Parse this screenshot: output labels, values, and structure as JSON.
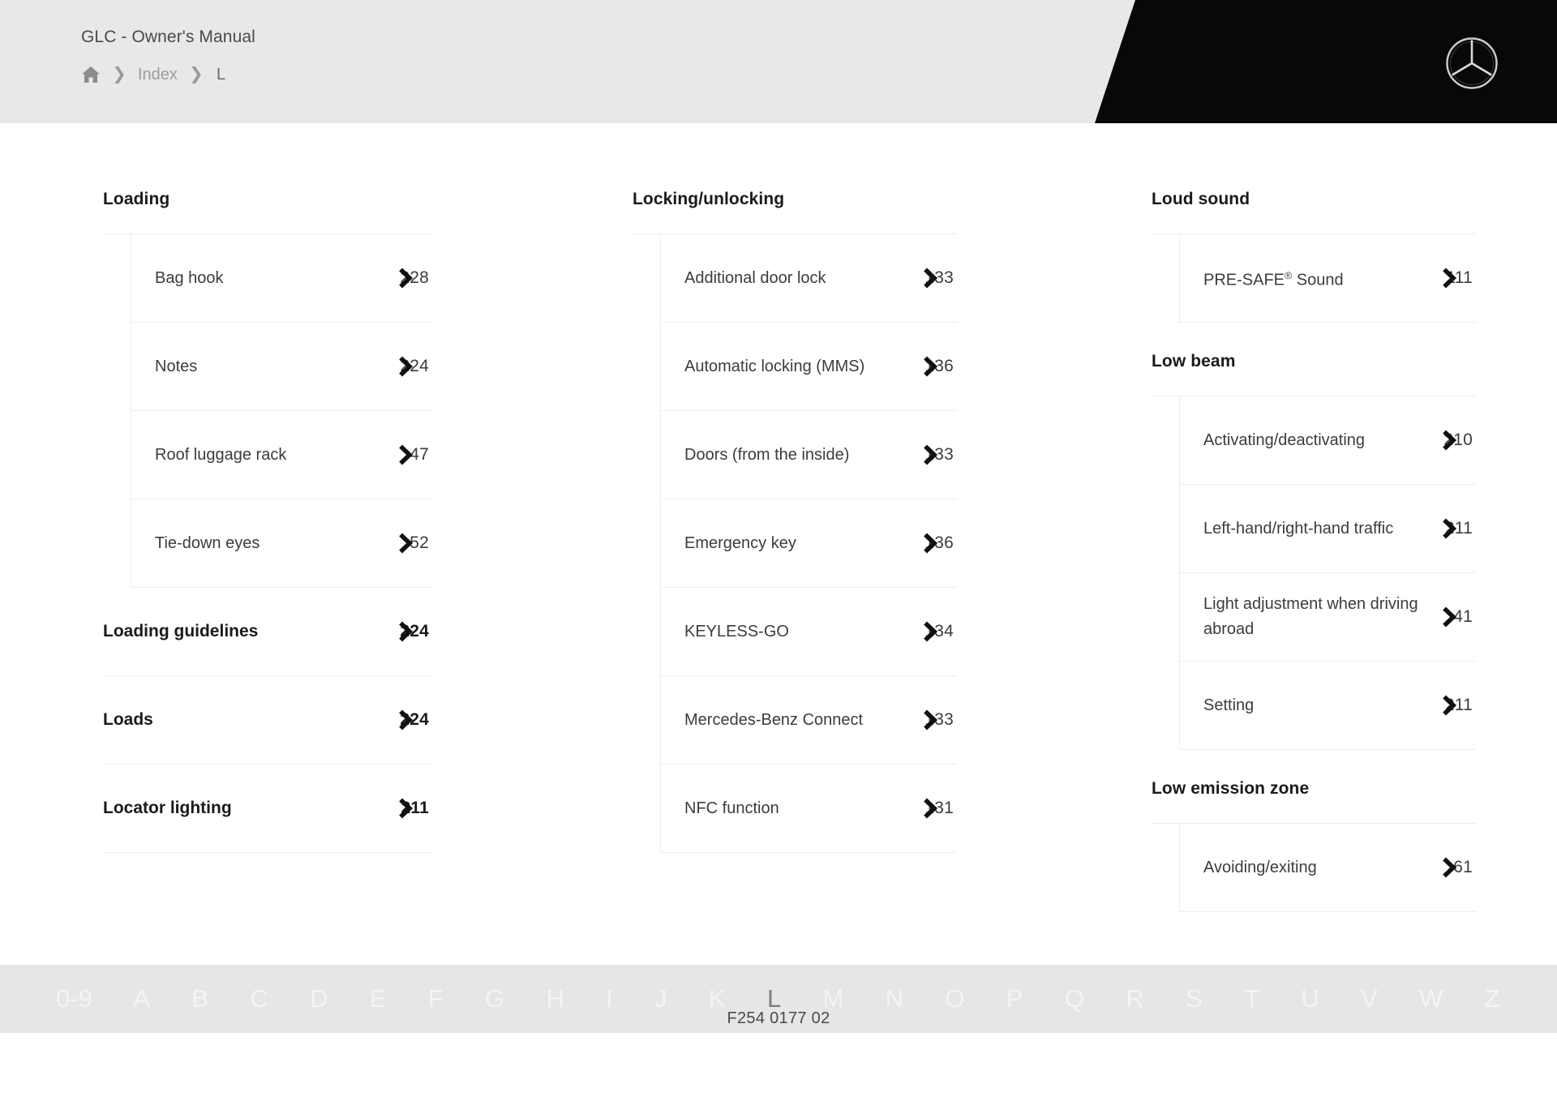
{
  "header": {
    "manual_title": "GLC - Owner's Manual",
    "breadcrumb": {
      "home_icon": "home-icon",
      "separator": "›",
      "items": [
        {
          "label": "Index",
          "current": false
        },
        {
          "label": "L",
          "current": true
        }
      ]
    },
    "brand_logo": "mercedes-benz-star-logo",
    "colors": {
      "header_bg": "#e8e8e8",
      "header_accent": "#080808",
      "text": "#4a4a4a"
    }
  },
  "index": {
    "columns": [
      {
        "id": "column-1",
        "blocks": [
          {
            "type": "group",
            "heading": "Loading",
            "items": [
              {
                "label": "Bag hook",
                "page": "228"
              },
              {
                "label": "Notes",
                "page": "224"
              },
              {
                "label": "Roof luggage rack",
                "page": "47"
              },
              {
                "label": "Tie-down eyes",
                "page": "52"
              }
            ]
          },
          {
            "type": "entry",
            "label": "Loading guidelines",
            "page": "224"
          },
          {
            "type": "entry",
            "label": "Loads",
            "page": "224"
          },
          {
            "type": "entry",
            "label": "Locator lighting",
            "page": "211"
          }
        ]
      },
      {
        "id": "column-2",
        "blocks": [
          {
            "type": "group",
            "heading": "Locking/unlocking",
            "items": [
              {
                "label": "Additional door lock",
                "page": "133"
              },
              {
                "label": "Automatic locking (MMS)",
                "page": "136"
              },
              {
                "label": "Doors (from the inside)",
                "page": "133"
              },
              {
                "label": "Emergency key",
                "page": "136"
              },
              {
                "label": "KEYLESS-GO",
                "page": "134"
              },
              {
                "label": "Mercedes-Benz Connect",
                "page": "133"
              },
              {
                "label": "NFC function",
                "page": "131"
              }
            ]
          }
        ]
      },
      {
        "id": "column-3",
        "blocks": [
          {
            "type": "group",
            "heading": "Loud sound",
            "items": [
              {
                "label": "PRE-SAFE® Sound",
                "page": "111",
                "sup": true
              }
            ]
          },
          {
            "type": "group",
            "heading": "Low beam",
            "items": [
              {
                "label": "Activating/deactivating",
                "page": "210"
              },
              {
                "label": "Left-hand/right-hand traffic",
                "page": "211"
              },
              {
                "label": "Light adjustment when driving abroad",
                "page": "41"
              },
              {
                "label": "Setting",
                "page": "211"
              }
            ]
          },
          {
            "type": "group",
            "heading": "Low emission zone",
            "items": [
              {
                "label": "Avoiding/exiting",
                "page": "61"
              }
            ]
          }
        ]
      }
    ]
  },
  "alphabet_bar": {
    "entries": [
      {
        "label": "0-9",
        "active": false
      },
      {
        "label": "A",
        "active": false
      },
      {
        "label": "B",
        "active": false
      },
      {
        "label": "C",
        "active": false
      },
      {
        "label": "D",
        "active": false
      },
      {
        "label": "E",
        "active": false
      },
      {
        "label": "F",
        "active": false
      },
      {
        "label": "G",
        "active": false
      },
      {
        "label": "H",
        "active": false
      },
      {
        "label": "I",
        "active": false
      },
      {
        "label": "J",
        "active": false
      },
      {
        "label": "K",
        "active": false
      },
      {
        "label": "L",
        "active": true
      },
      {
        "label": "M",
        "active": false
      },
      {
        "label": "N",
        "active": false
      },
      {
        "label": "O",
        "active": false
      },
      {
        "label": "P",
        "active": false
      },
      {
        "label": "Q",
        "active": false
      },
      {
        "label": "R",
        "active": false
      },
      {
        "label": "S",
        "active": false
      },
      {
        "label": "T",
        "active": false
      },
      {
        "label": "U",
        "active": false
      },
      {
        "label": "V",
        "active": false
      },
      {
        "label": "W",
        "active": false
      },
      {
        "label": "Z",
        "active": false
      }
    ],
    "document_code": "F254 0177 02"
  }
}
